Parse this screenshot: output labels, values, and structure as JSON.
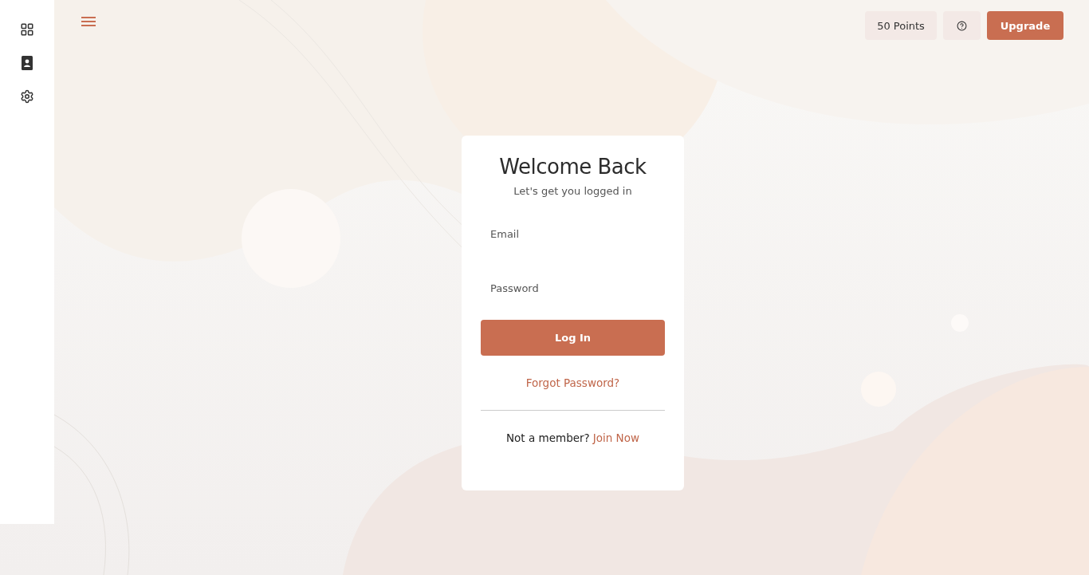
{
  "top_bar": {
    "points": "50 Points",
    "upgrade": "Upgrade"
  },
  "login": {
    "title": "Welcome Back",
    "subtitle": "Let's get you logged in",
    "email": {
      "placeholder": "Email"
    },
    "password": {
      "placeholder": "Password"
    },
    "submit": "Log In",
    "forgot": "Forgot Password?",
    "signup_prompt": "Not a member?",
    "signup_link": "Join Now"
  }
}
